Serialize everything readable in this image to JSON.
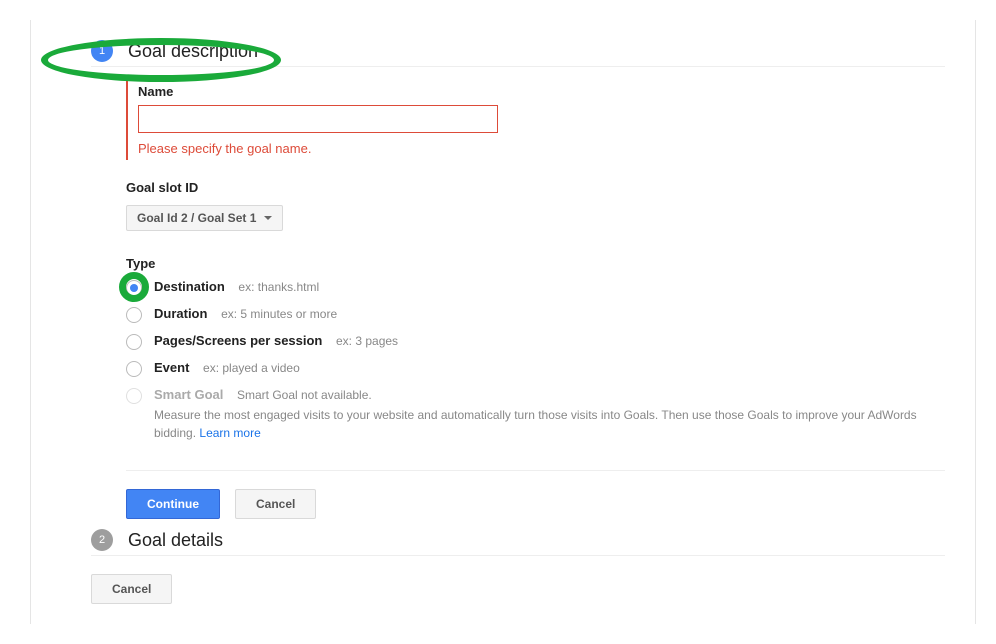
{
  "step1": {
    "num": "1",
    "title": "Goal description"
  },
  "step2": {
    "num": "2",
    "title": "Goal details"
  },
  "name": {
    "label": "Name",
    "value": "",
    "error": "Please specify the goal name."
  },
  "slot": {
    "label": "Goal slot ID",
    "selected": "Goal Id 2 / Goal Set 1"
  },
  "type": {
    "label": "Type",
    "options": [
      {
        "label": "Destination",
        "example": "ex: thanks.html",
        "checked": true,
        "disabled": false
      },
      {
        "label": "Duration",
        "example": "ex: 5 minutes or more",
        "checked": false,
        "disabled": false
      },
      {
        "label": "Pages/Screens per session",
        "example": "ex: 3 pages",
        "checked": false,
        "disabled": false
      },
      {
        "label": "Event",
        "example": "ex: played a video",
        "checked": false,
        "disabled": false
      },
      {
        "label": "Smart Goal",
        "example": "Smart Goal not available.",
        "checked": false,
        "disabled": true,
        "desc": "Measure the most engaged visits to your website and automatically turn those visits into Goals. Then use those Goals to improve your AdWords bidding.",
        "link": "Learn more"
      }
    ]
  },
  "buttons": {
    "continue": "Continue",
    "cancel": "Cancel",
    "outerCancel": "Cancel"
  }
}
